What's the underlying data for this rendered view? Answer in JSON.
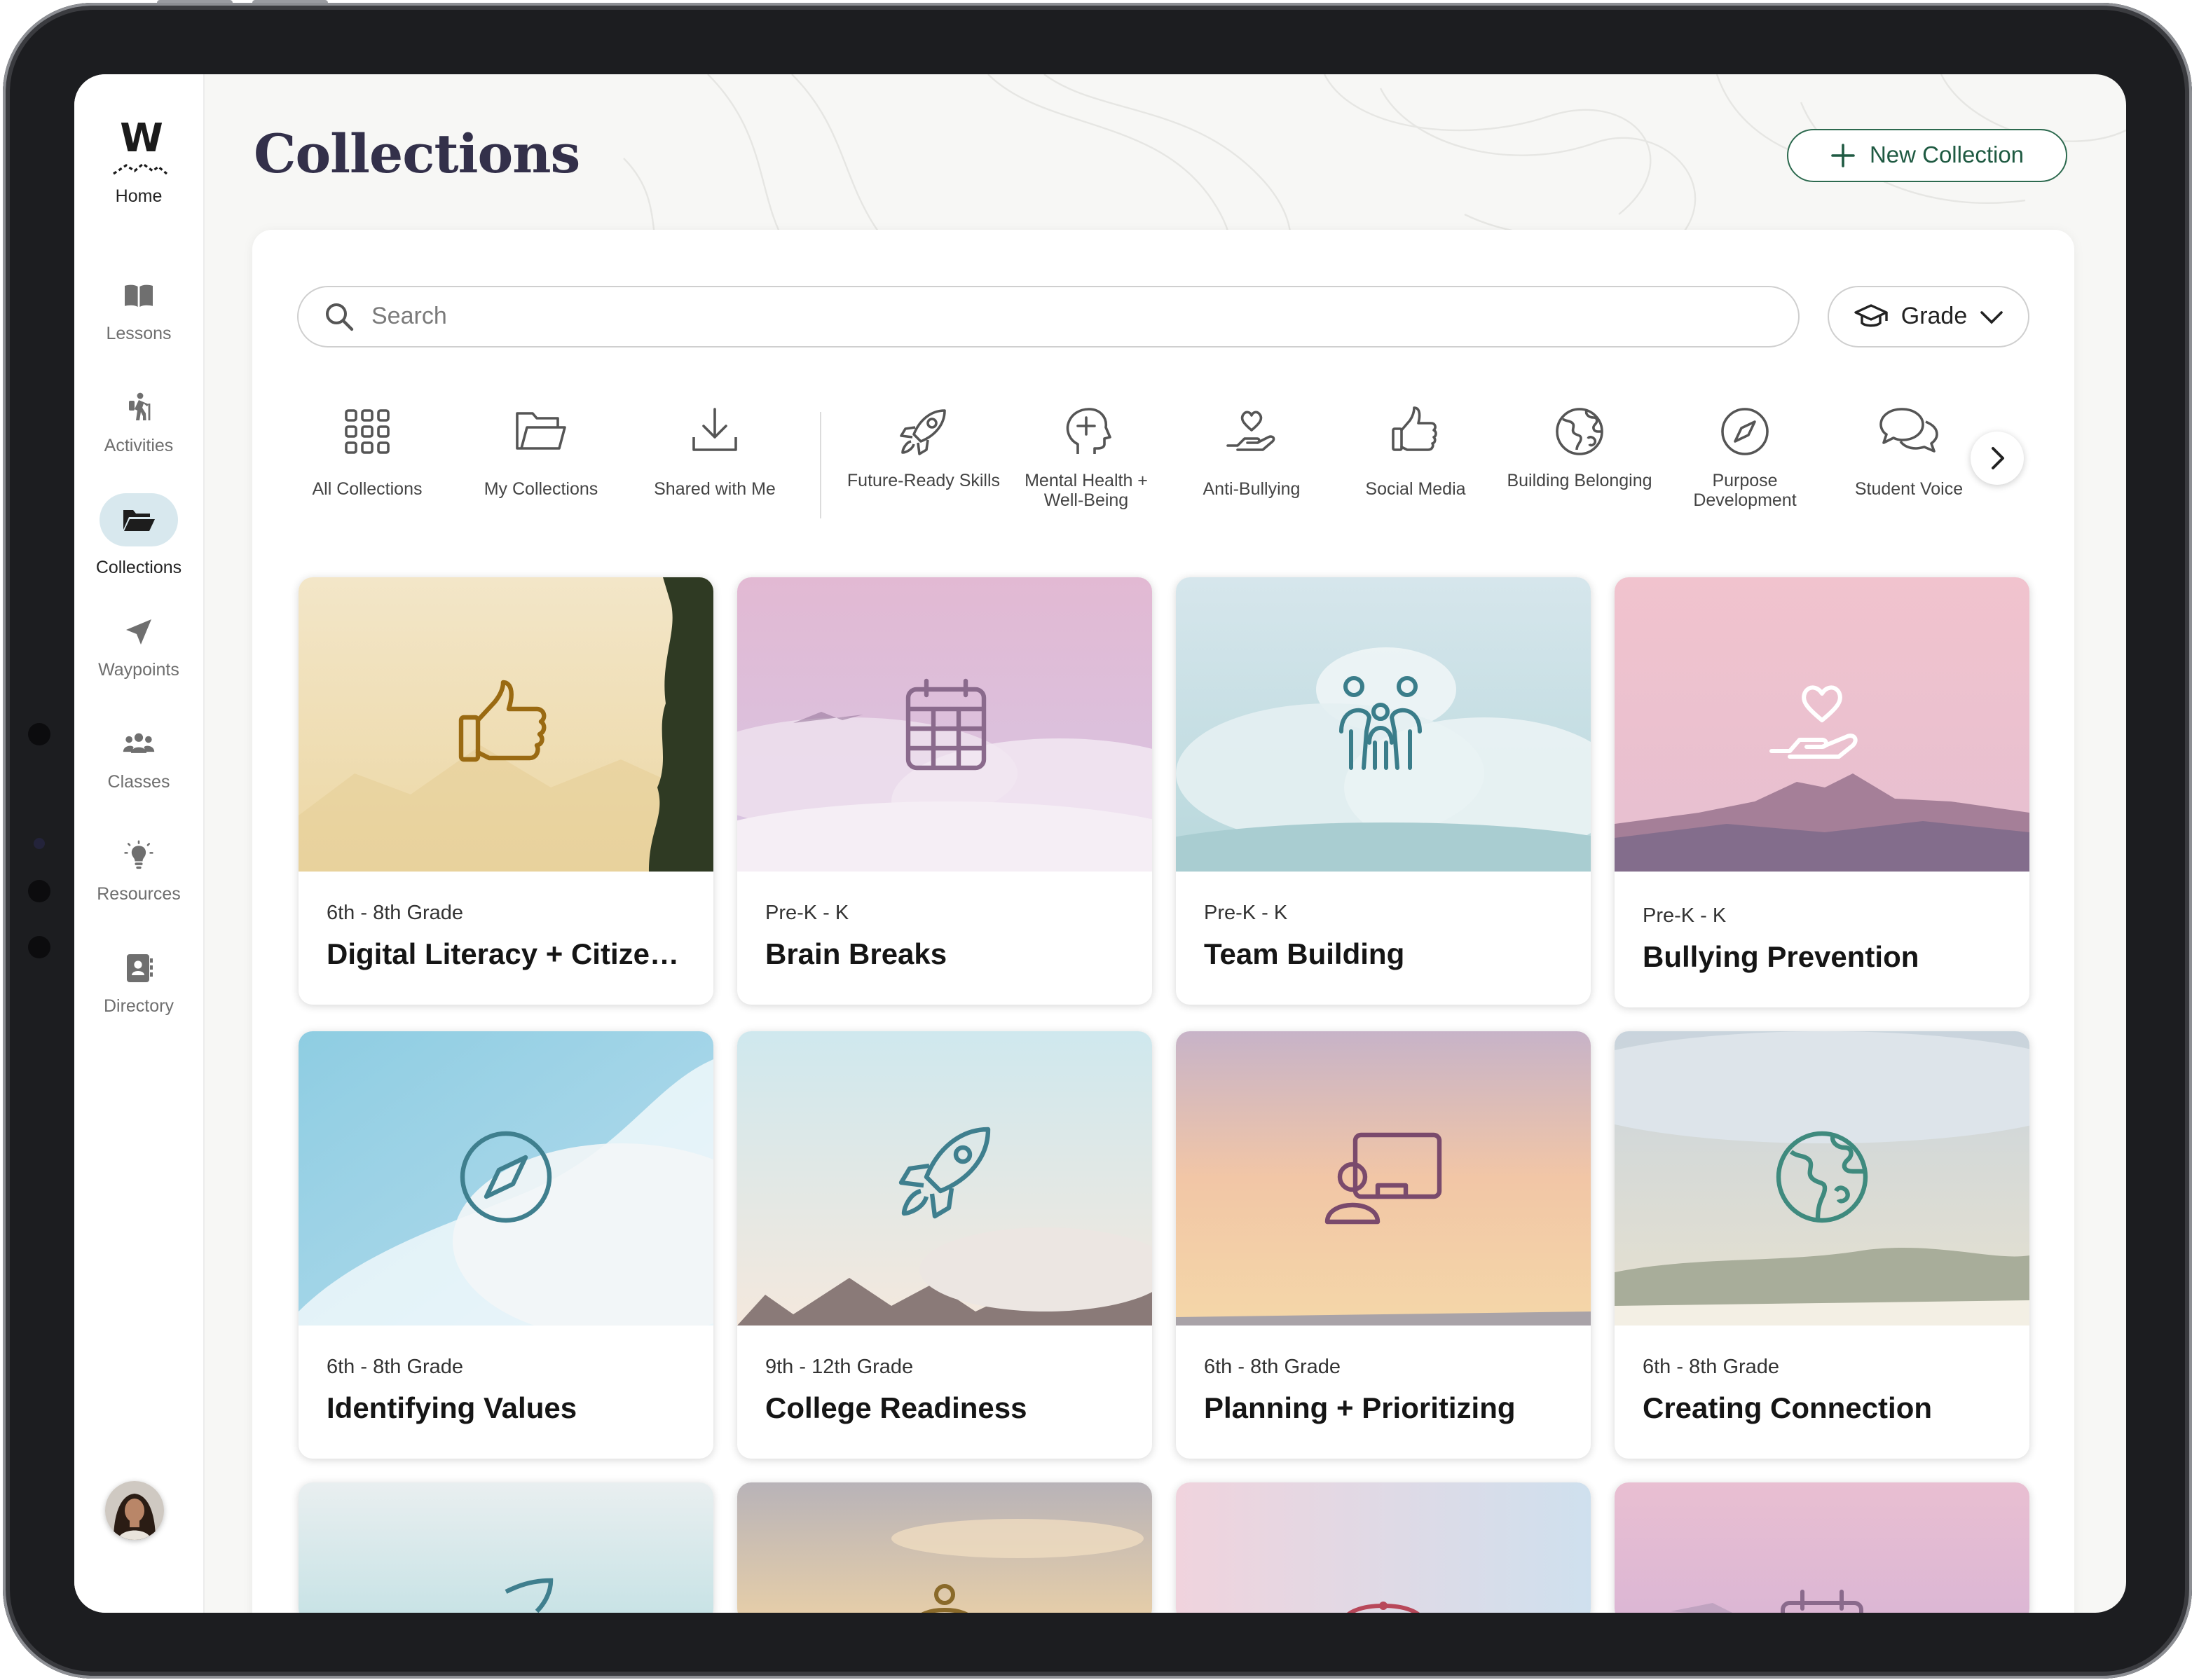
{
  "sidebar": {
    "logo": "W",
    "home_label": "Home",
    "items": [
      {
        "label": "Lessons",
        "icon": "book-icon"
      },
      {
        "label": "Activities",
        "icon": "hiker-icon"
      },
      {
        "label": "Collections",
        "icon": "folder-open-icon",
        "active": true
      },
      {
        "label": "Waypoints",
        "icon": "navigation-arrow-icon"
      },
      {
        "label": "Classes",
        "icon": "people-group-icon"
      },
      {
        "label": "Resources",
        "icon": "lightbulb-icon"
      },
      {
        "label": "Directory",
        "icon": "contact-book-icon"
      }
    ]
  },
  "header": {
    "title": "Collections",
    "new_button_label": "New Collection"
  },
  "search": {
    "placeholder": "Search"
  },
  "grade_filter": {
    "label": "Grade"
  },
  "categories": [
    {
      "label": "All Collections",
      "icon": "grid-icon"
    },
    {
      "label": "My Collections",
      "icon": "folder-icon"
    },
    {
      "label": "Shared with Me",
      "icon": "download-icon"
    },
    {
      "label": "Future-Ready Skills",
      "icon": "rocket-icon"
    },
    {
      "label": "Mental Health + Well-Being",
      "icon": "head-plus-icon"
    },
    {
      "label": "Anti-Bullying",
      "icon": "heart-hand-icon"
    },
    {
      "label": "Social Media",
      "icon": "thumbs-up-icon"
    },
    {
      "label": "Building Belonging",
      "icon": "globe-icon"
    },
    {
      "label": "Purpose Development",
      "icon": "compass-icon"
    },
    {
      "label": "Student Voice",
      "icon": "chat-bubbles-icon"
    }
  ],
  "cards": [
    {
      "grade": "6th - 8th Grade",
      "title": "Digital Literacy + Citizenship",
      "icon": "thumbs-up-icon",
      "icon_color": "#9a6a12"
    },
    {
      "grade": "Pre-K - K",
      "title": "Brain Breaks",
      "icon": "calendar-icon",
      "icon_color": "#8a6a8c"
    },
    {
      "grade": "Pre-K - K",
      "title": "Team Building",
      "icon": "family-icon",
      "icon_color": "#3a7d8a"
    },
    {
      "grade": "Pre-K - K",
      "title": "Bullying Prevention",
      "icon": "heart-hand-icon",
      "icon_color": "#ffffff"
    },
    {
      "grade": "6th - 8th Grade",
      "title": "Identifying Values",
      "icon": "compass-icon",
      "icon_color": "#3f7f8e"
    },
    {
      "grade": "9th - 12th Grade",
      "title": "College Readiness",
      "icon": "rocket-icon",
      "icon_color": "#3f7f8e"
    },
    {
      "grade": "6th - 8th Grade",
      "title": "Planning + Prioritizing",
      "icon": "presenter-icon",
      "icon_color": "#7a4a6c"
    },
    {
      "grade": "6th - 8th Grade",
      "title": "Creating Connection",
      "icon": "globe-icon",
      "icon_color": "#3f8a7e"
    }
  ],
  "stub_cards": [
    {
      "icon": "rocket-icon",
      "icon_color": "#3f7f8e"
    },
    {
      "icon": "bell-icon",
      "icon_color": "#8a6a2a"
    },
    {
      "icon": "lock-icon",
      "icon_color": "#b8485a"
    },
    {
      "icon": "calendar-icon",
      "icon_color": "#8a6a8c"
    }
  ]
}
